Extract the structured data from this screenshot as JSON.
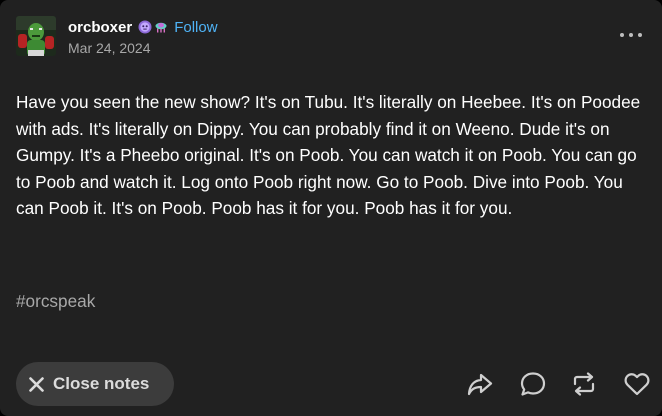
{
  "post": {
    "username": "orcboxer",
    "follow_label": "Follow",
    "date": "Mar 24, 2024",
    "body": "Have you seen the new show? It's on Tubu. It's literally on Heebee. It's on Poodee with ads. It's literally on Dippy. You can probably find it on Weeno. Dude it's on Gumpy. It's a Pheebo original. It's on Poob. You can watch it on Poob. You can go to Poob and watch it. Log onto Poob right now. Go to Poob. Dive into Poob. You can Poob it. It's on Poob. Poob has it for you. Poob has it for you.",
    "tag": "#orcspeak",
    "close_notes_label": "Close notes"
  },
  "icons": {
    "avatar": "orc-boxer-avatar",
    "badge_1": "purple-ghost-badge-icon",
    "badge_2": "alien-badge-icon",
    "more": "more-options-icon",
    "close": "close-icon",
    "share": "share-icon",
    "reply": "reply-icon",
    "reblog": "reblog-icon",
    "like": "heart-icon"
  },
  "colors": {
    "background": "#212121",
    "text": "#ffffff",
    "muted": "#a8a8a8",
    "follow": "#4fb3f6",
    "button_bg": "#3c3c3c"
  }
}
